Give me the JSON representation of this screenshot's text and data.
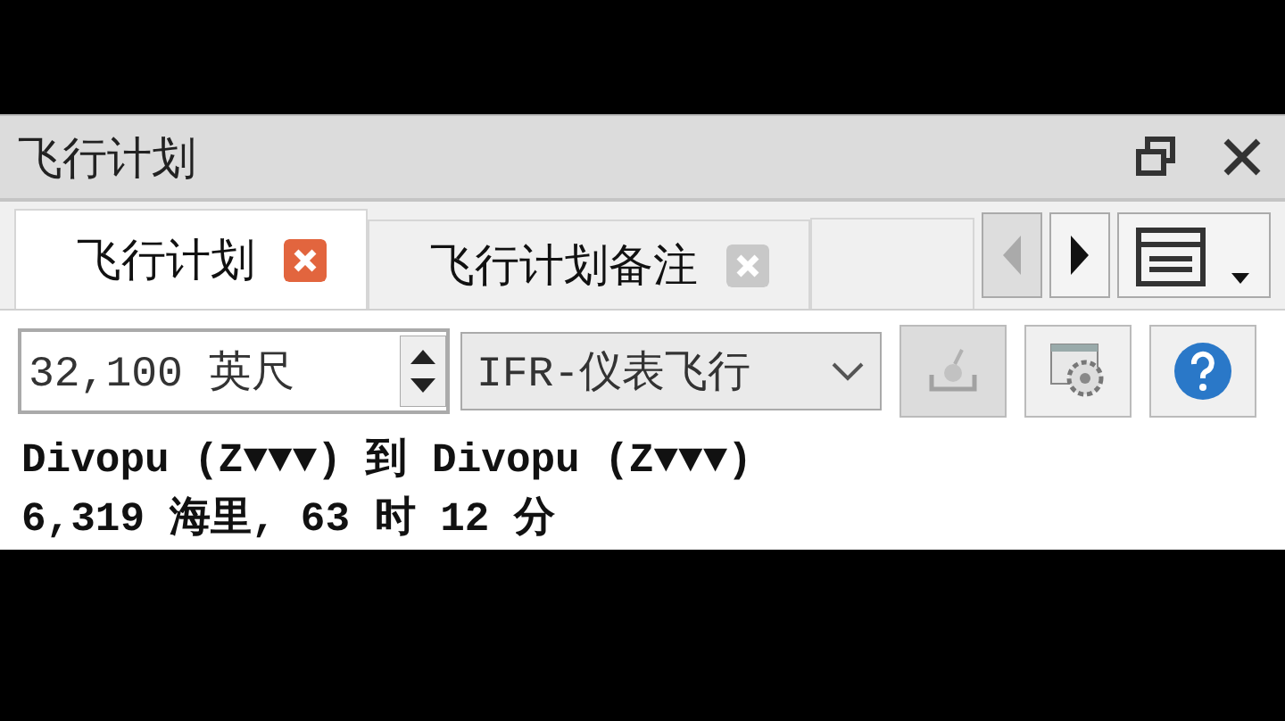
{
  "panel": {
    "title": "飞行计划"
  },
  "tabs": [
    {
      "label": "飞行计划",
      "selected": true
    },
    {
      "label": "飞行计划备注",
      "selected": false
    }
  ],
  "toolbar": {
    "altitude": "32,100 英尺",
    "flight_rules": "IFR-仪表飞行",
    "tools": [
      {
        "kind": "export",
        "disabled": true
      },
      {
        "kind": "settings",
        "disabled": false
      },
      {
        "kind": "help",
        "disabled": false
      }
    ]
  },
  "summary": [
    "Divopu (Z▼▼▼) 到 Divopu (Z▼▼▼)",
    "6,319 海里, 63 时 12 分"
  ]
}
